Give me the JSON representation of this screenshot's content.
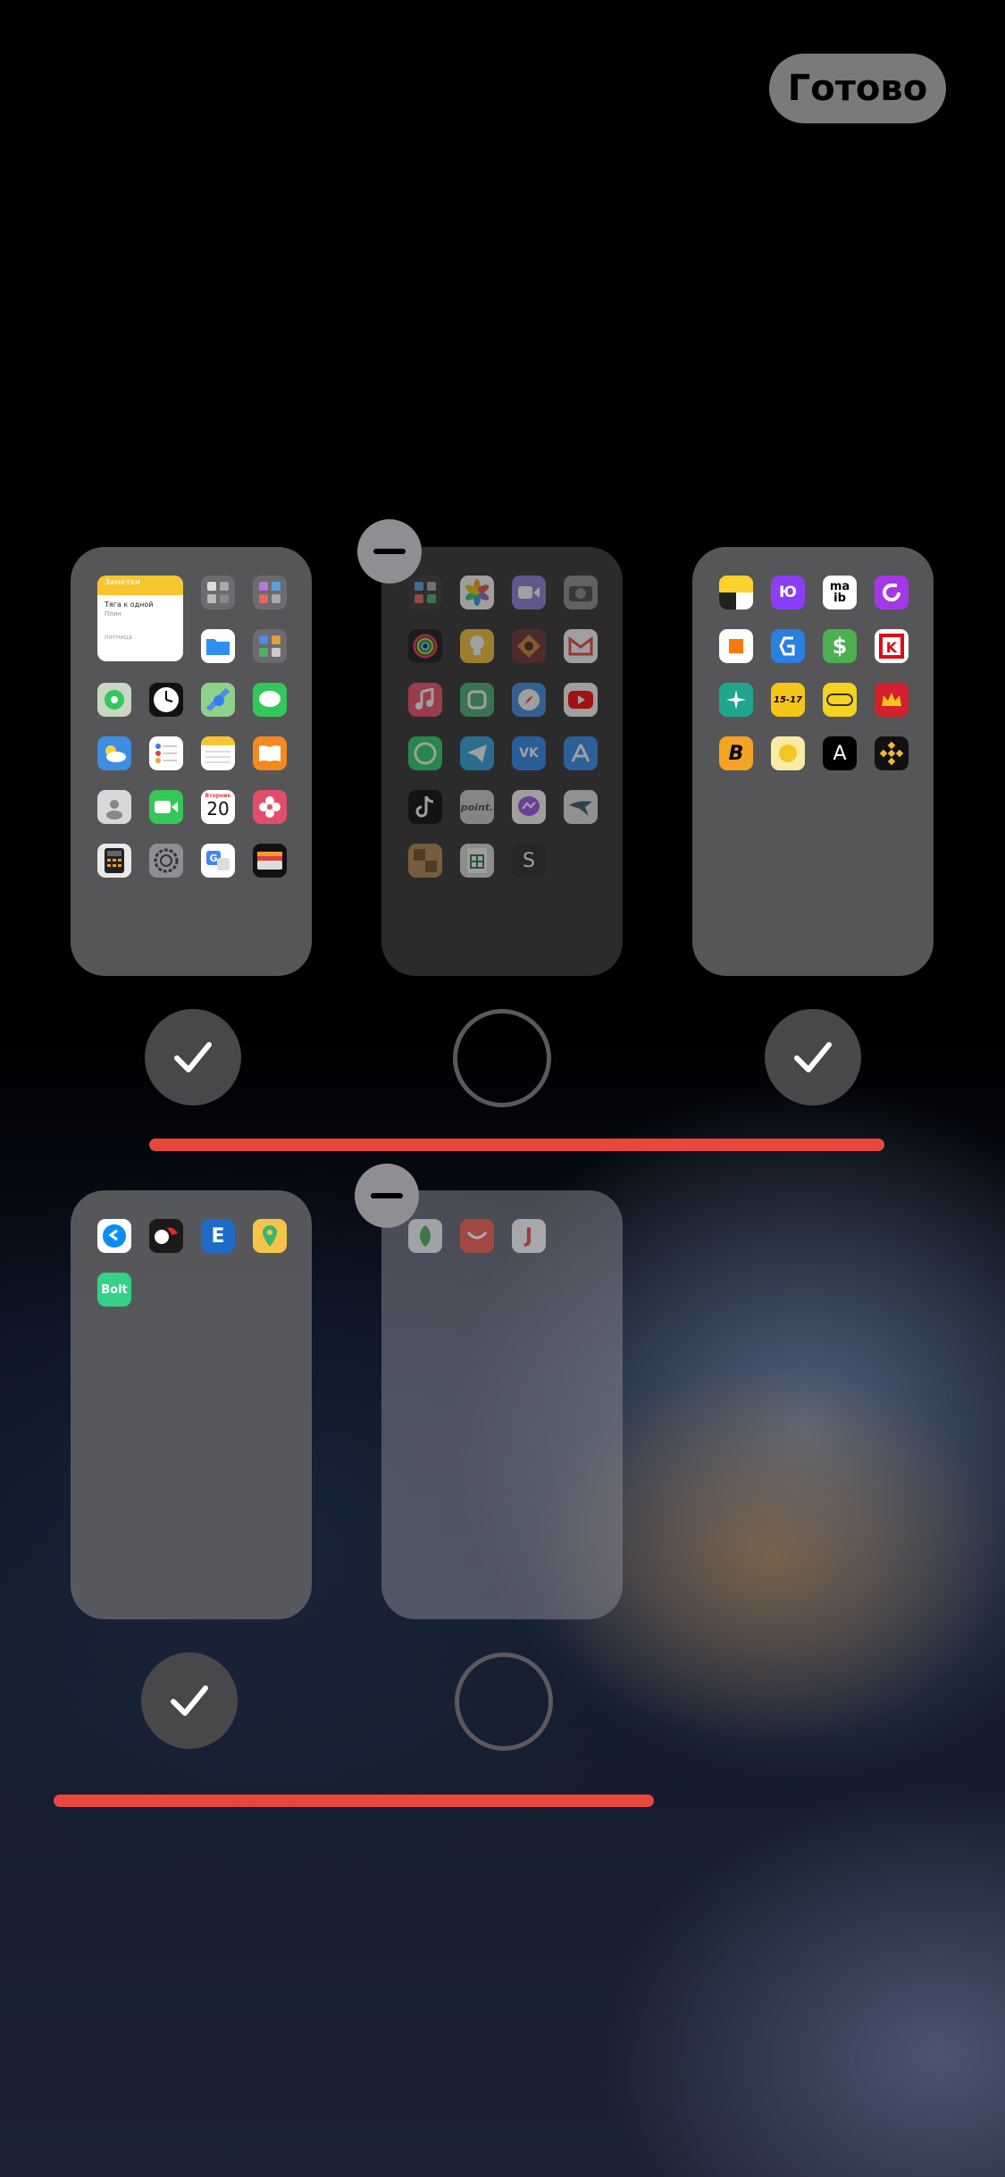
{
  "header": {
    "done_label": "Готово"
  },
  "widget": {
    "title": "Заметки",
    "line1": "Тяга к одной",
    "line2": "Плин",
    "footer": "пятница"
  },
  "calendar": {
    "day_label": "Вторник",
    "day_number": "20"
  },
  "pages": [
    {
      "visible": true,
      "icons": [
        "notes-widget",
        "folder-icon",
        "folder-icon",
        "files-icon",
        "folder-icon",
        "find-my-icon",
        "clock-icon",
        "maps-icon",
        "messages-icon",
        "weather-icon",
        "reminders-icon",
        "notes-icon",
        "books-icon",
        "contacts-icon",
        "facetime-icon",
        "calendar-icon",
        "flower-icon",
        "calculator-icon",
        "settings-icon",
        "translate-icon",
        "wallet-icon"
      ]
    },
    {
      "visible": false,
      "icons": [
        "folder-icon",
        "photos-icon",
        "video-icon",
        "camera-icon",
        "activity-icon",
        "bulb-icon",
        "game-icon",
        "gmail-icon",
        "music-icon",
        "mi-icon",
        "safari-icon",
        "youtube-icon",
        "whatsapp-icon",
        "telegram-icon",
        "vk-icon",
        "app-store-icon",
        "tiktok-icon",
        "point-icon",
        "messenger-icon",
        "bird-icon",
        "chess-icon",
        "sheets-icon",
        "s-icon"
      ]
    },
    {
      "visible": true,
      "icons": [
        "yandex-icon",
        "yumoney-icon",
        "maib-icon",
        "refresh-icon",
        "orange-icon",
        "blue-app-icon",
        "dollar-icon",
        "kaufland-icon",
        "sparkle-icon",
        "taxi-icon",
        "ticket-icon",
        "crown-icon",
        "b-icon",
        "coin-icon",
        "a-icon",
        "binance-icon"
      ]
    },
    {
      "visible": true,
      "icons": [
        "shazam-icon",
        "fonbet-icon",
        "e-icon",
        "pin-icon",
        "bolt-icon"
      ]
    },
    {
      "visible": false,
      "icons": [
        "leaf-icon",
        "aliexpress-icon",
        "j-icon"
      ]
    }
  ],
  "app_labels": {
    "mai": "ma",
    "ib": "ib",
    "bolt": "Bolt",
    "vk": "VK",
    "e": "E",
    "a": "A",
    "s": "S",
    "b": "B",
    "point": "point.",
    "taxi": "15-17",
    "dollar": "$",
    "yu": "Ю",
    "j": "J",
    "k": "K"
  },
  "colors": {
    "accent_red": "#e8473b",
    "done_bg": "#7a7a7a"
  }
}
